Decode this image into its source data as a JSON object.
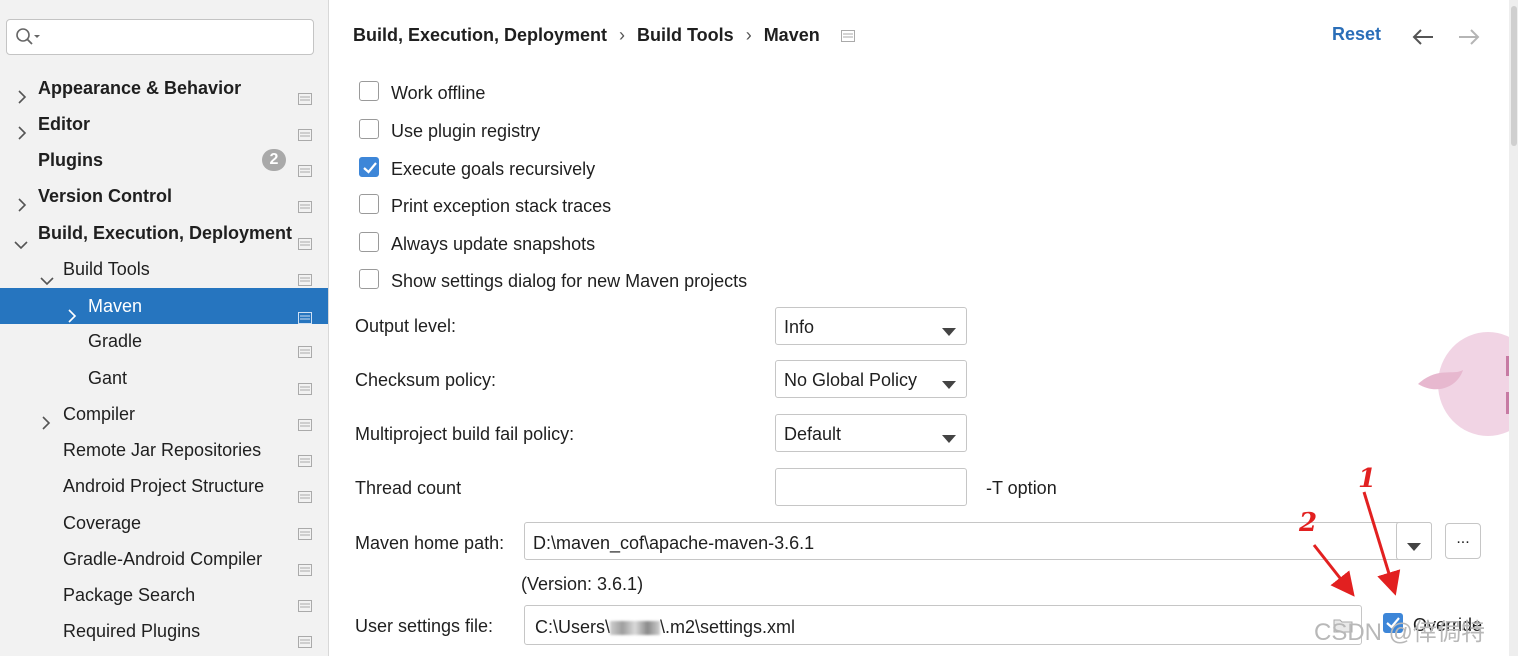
{
  "search": {
    "value": "",
    "placeholder": ""
  },
  "sidebar": {
    "items": [
      {
        "label": "Appearance & Behavior"
      },
      {
        "label": "Editor"
      },
      {
        "label": "Plugins",
        "badge": "2"
      },
      {
        "label": "Version Control"
      },
      {
        "label": "Build, Execution, Deployment"
      },
      {
        "label": "Build Tools"
      },
      {
        "label": "Maven"
      },
      {
        "label": "Gradle"
      },
      {
        "label": "Gant"
      },
      {
        "label": "Compiler"
      },
      {
        "label": "Remote Jar Repositories"
      },
      {
        "label": "Android Project Structure"
      },
      {
        "label": "Coverage"
      },
      {
        "label": "Gradle-Android Compiler"
      },
      {
        "label": "Package Search"
      },
      {
        "label": "Required Plugins"
      }
    ]
  },
  "header": {
    "breadcrumb": [
      "Build, Execution, Deployment",
      "Build Tools",
      "Maven"
    ],
    "separator": "›",
    "reset_label": "Reset"
  },
  "options": [
    {
      "label": "Work offline",
      "checked": false
    },
    {
      "label": "Use plugin registry",
      "checked": false
    },
    {
      "label": "Execute goals recursively",
      "checked": true
    },
    {
      "label": "Print exception stack traces",
      "checked": false
    },
    {
      "label": "Always update snapshots",
      "checked": false
    },
    {
      "label": "Show settings dialog for new Maven projects",
      "checked": false
    }
  ],
  "fields": {
    "output_level": {
      "label": "Output level:",
      "value": "Info"
    },
    "checksum_policy": {
      "label": "Checksum policy:",
      "value": "No Global Policy"
    },
    "fail_policy": {
      "label": "Multiproject build fail policy:",
      "value": "Default"
    },
    "thread_count": {
      "label": "Thread count",
      "value": "",
      "suffix": "-T option"
    },
    "maven_home": {
      "label": "Maven home path:",
      "value": "D:\\maven_cof\\apache-maven-3.6.1",
      "browse": "...",
      "version": "(Version: 3.6.1)"
    },
    "user_settings": {
      "label": "User settings file:",
      "value_prefix": "C:\\Users\\",
      "value_suffix": "\\.m2\\settings.xml",
      "override_label": "Override",
      "override_checked": true
    }
  },
  "annotations": {
    "one": "1",
    "two": "2"
  },
  "watermark": "CSDN @倖侷特",
  "colors": {
    "selection": "#2675bf",
    "link": "#2a6eb8",
    "check": "#3d86d8",
    "annotation": "#e22020"
  },
  "icons": [
    "search-icon",
    "chevron-right-icon",
    "chevron-down-icon",
    "page-icon",
    "back-arrow-icon",
    "forward-arrow-icon",
    "dropdown-arrow-icon",
    "folder-icon"
  ]
}
